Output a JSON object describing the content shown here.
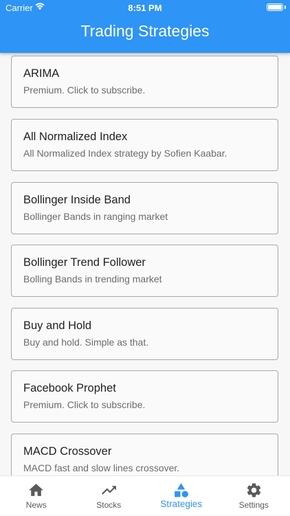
{
  "status_bar": {
    "carrier": "Carrier",
    "time": "8:51 PM"
  },
  "header": {
    "title": "Trading Strategies"
  },
  "strategies": [
    {
      "title": "ARIMA",
      "subtitle": "Premium. Click to subscribe."
    },
    {
      "title": "All Normalized Index",
      "subtitle": "All Normalized Index strategy by Sofien Kaabar."
    },
    {
      "title": "Bollinger Inside Band",
      "subtitle": "Bollinger Bands in ranging market"
    },
    {
      "title": "Bollinger Trend Follower",
      "subtitle": "Bolling Bands in trending market"
    },
    {
      "title": "Buy and Hold",
      "subtitle": "Buy and hold. Simple as that."
    },
    {
      "title": "Facebook Prophet",
      "subtitle": "Premium. Click to subscribe."
    },
    {
      "title": "MACD Crossover",
      "subtitle": "MACD fast and slow lines crossover."
    }
  ],
  "tabs": [
    {
      "label": "News",
      "icon": "home-icon"
    },
    {
      "label": "Stocks",
      "icon": "trending-up-icon"
    },
    {
      "label": "Strategies",
      "icon": "shapes-icon"
    },
    {
      "label": "Settings",
      "icon": "gear-icon"
    }
  ],
  "colors": {
    "accent": "#2e94f5",
    "inactive": "#5a5a5a"
  }
}
